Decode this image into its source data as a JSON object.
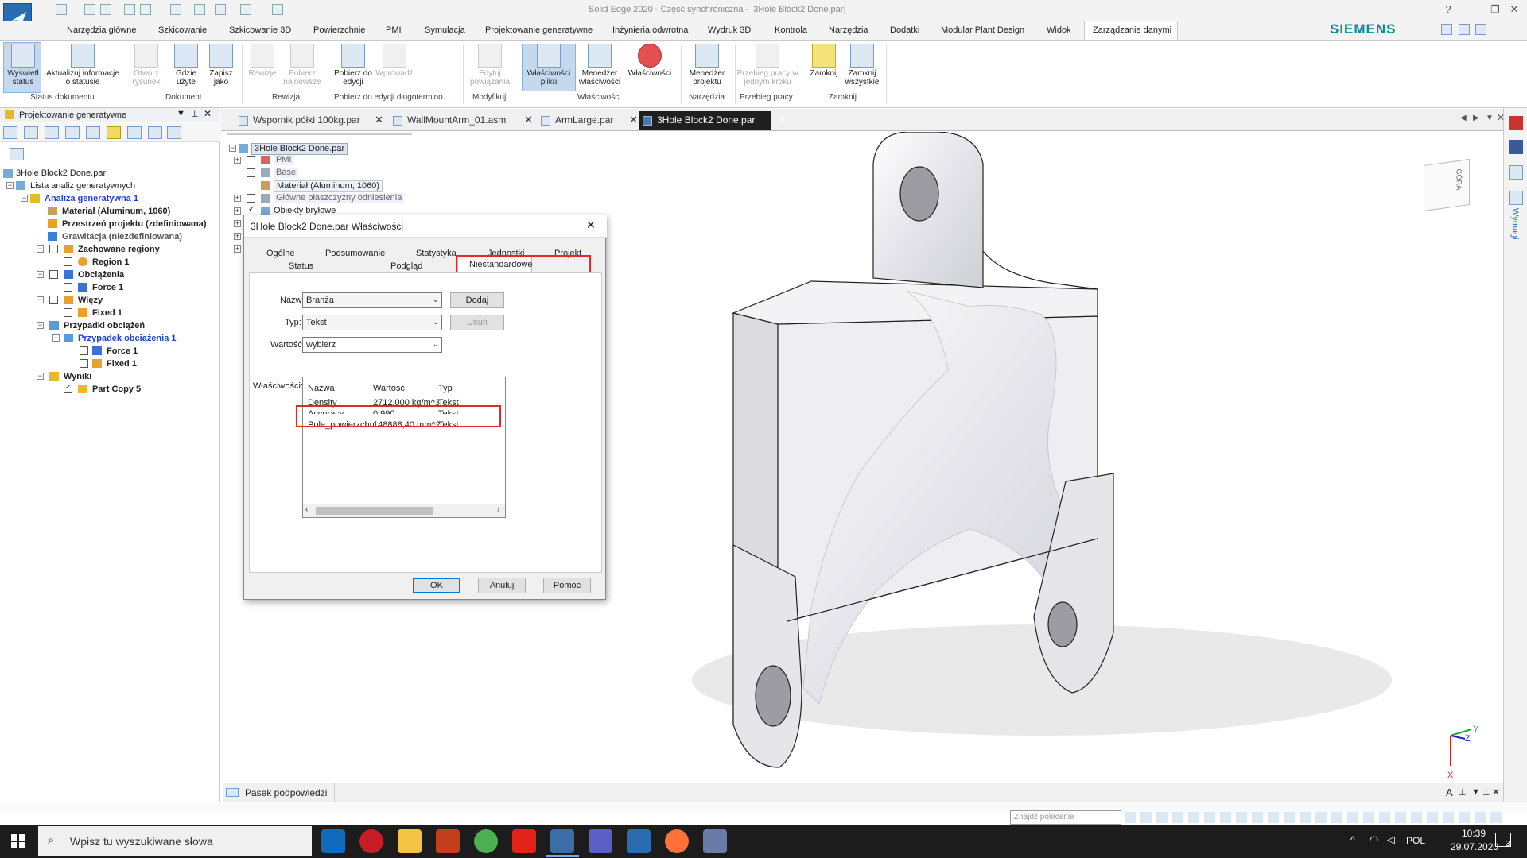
{
  "app": {
    "title": "Solid Edge 2020 - Część synchroniczna - [3Hole Block2 Done.par]",
    "brand": "SIEMENS"
  },
  "ribbon_tabs": [
    "Narzędzia główne",
    "Szkicowanie",
    "Szkicowanie 3D",
    "Powierzchnie",
    "PMI",
    "Symulacja",
    "Projektowanie generatywne",
    "Inżynieria odwrotna",
    "Wydruk 3D",
    "Kontrola",
    "Narzędzia",
    "Dodatki",
    "Modular Plant Design",
    "Widok",
    "Zarządzanie danymi"
  ],
  "ribbon": {
    "buttons": [
      {
        "label": "Wyświetl status",
        "disabled": false
      },
      {
        "label": "Aktualizuj informacje o statusie",
        "disabled": false
      },
      {
        "label": "Otwórz rysunek",
        "disabled": true
      },
      {
        "label": "Gdzie użyte",
        "disabled": false
      },
      {
        "label": "Zapisz jako",
        "disabled": false
      },
      {
        "label": "Rewizje",
        "disabled": true
      },
      {
        "label": "Pobierz najnowsze",
        "disabled": true
      },
      {
        "label": "Pobierz do edycji",
        "disabled": false
      },
      {
        "label": "Wprowadź",
        "disabled": true
      },
      {
        "label": "Edytuj powiązania",
        "disabled": true
      },
      {
        "label": "Właściwości pliku",
        "disabled": false
      },
      {
        "label": "Menedżer właściwości",
        "disabled": false
      },
      {
        "label": "Właściwości",
        "disabled": false
      },
      {
        "label": "Menedżer projektu",
        "disabled": false
      },
      {
        "label": "Przebieg pracy w jednym kroku",
        "disabled": true
      },
      {
        "label": "Zamknij",
        "disabled": false
      },
      {
        "label": "Zamknij wszystkie",
        "disabled": false
      }
    ],
    "groups": [
      "Status dokumentu",
      "Dokument",
      "Rewizja",
      "Pobierz do edycji długotermino...",
      "Modyfikuj",
      "Właściwości",
      "Narzędzia",
      "Przebieg pracy",
      "Zamknij"
    ]
  },
  "left_panel": {
    "title": "Projektowanie generatywne",
    "tree": [
      {
        "text": "3Hole Block2 Done.par",
        "style": ""
      },
      {
        "text": "Lista analiz generatywnych",
        "style": ""
      },
      {
        "text": "Analiza generatywna 1",
        "style": "b blue"
      },
      {
        "text": "Materiał (Aluminum, 1060)",
        "style": "b"
      },
      {
        "text": "Przestrzeń projektu (zdefiniowana)",
        "style": "b"
      },
      {
        "text": "Grawitacja (niezdefiniowana)",
        "style": "b gray"
      },
      {
        "text": "Zachowane regiony",
        "style": "b"
      },
      {
        "text": "Region 1",
        "style": "b"
      },
      {
        "text": "Obciążenia",
        "style": "b"
      },
      {
        "text": "Force 1",
        "style": "b"
      },
      {
        "text": "Więzy",
        "style": "b"
      },
      {
        "text": "Fixed 1",
        "style": "b"
      },
      {
        "text": "Przypadki obciążeń",
        "style": "b"
      },
      {
        "text": "Przypadek obciążenia 1",
        "style": "b blue"
      },
      {
        "text": "Force 1",
        "style": "b"
      },
      {
        "text": "Fixed 1",
        "style": "b"
      },
      {
        "text": "Wyniki",
        "style": "b"
      },
      {
        "text": "Part Copy 5",
        "style": "b"
      }
    ]
  },
  "doc_tabs": [
    "Wspornik półki 100kg.par",
    "WallMountArm_01.asm",
    "ArmLarge.par",
    "3Hole Block2 Done.par"
  ],
  "viewport_tree": [
    "3Hole Block2 Done.par",
    "PMI",
    "Base",
    "Materiał (Aluminum, 1060)",
    "Główne płaszczyzny odniesienia",
    "Obiekty bryłowe"
  ],
  "dialog": {
    "title": "3Hole Block2 Done.par Właściwości",
    "tabs_row1": [
      "Ogólne",
      "Podsumowanie",
      "Statystyka",
      "Jednostki",
      "Projekt"
    ],
    "tabs_row2": [
      "Status",
      "Podgląd",
      "Niestandardowe"
    ],
    "name_label": "Nazwa:",
    "name_value": "Branża",
    "type_label": "Typ:",
    "type_value": "Tekst",
    "value_label": "Wartość:",
    "value_value": "wybierz",
    "add_button": "Dodaj",
    "delete_button": "Usuń",
    "props_label": "Właściwości:",
    "columns": [
      "Nazwa",
      "Wartość",
      "Typ"
    ],
    "rows": [
      [
        "Density",
        "2712,000 kg/m^3",
        "Tekst"
      ],
      [
        "Accuracy",
        "0,990",
        "Tekst"
      ],
      [
        "Pole_powierzchni",
        "148888,40 mm^2",
        "Tekst"
      ]
    ],
    "ok": "OK",
    "cancel": "Anuluj",
    "help": "Pomoc"
  },
  "viewcube_label": "GÓRA",
  "axes": {
    "y": "Y",
    "z": "Z",
    "x": "X"
  },
  "hint_bar": "Pasek podpowiedzi",
  "command_search_placeholder": "Znajdź polecenie",
  "right_strip_label": "Wymagi",
  "taskbar": {
    "search_placeholder": "Wpisz tu wyszukiwane słowa",
    "language": "POL",
    "time": "10:39",
    "date": "29.07.2020",
    "notifications": "3"
  },
  "colors": {
    "accent": "#0078d7",
    "highlight_box": "#e02b2b",
    "siemens": "#0b8a98",
    "taskbar": "#1c1c1c"
  }
}
